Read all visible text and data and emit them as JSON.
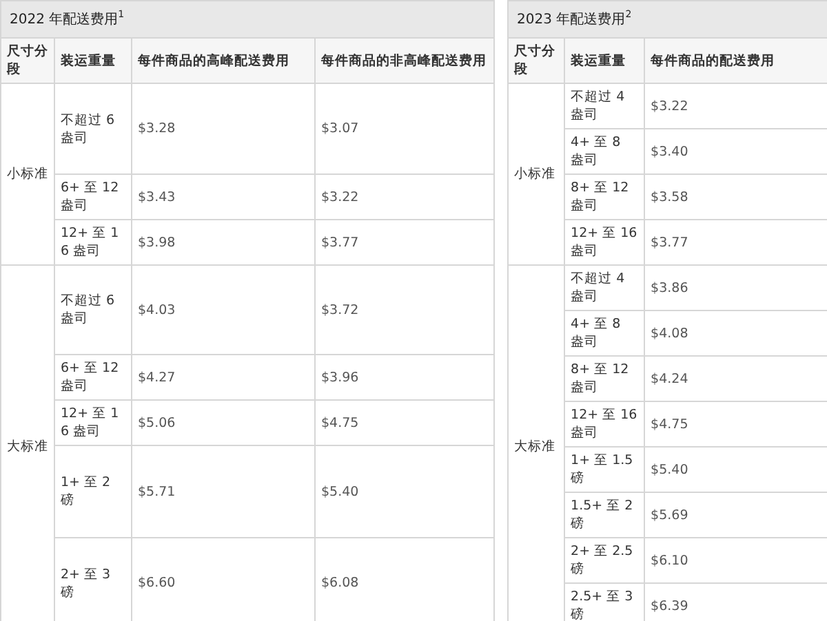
{
  "tables": [
    {
      "title": "2022 年配送费用$^{1}$",
      "columns": [
        "尺寸分段",
        "装运重量",
        "每件商品的高峰配送费用",
        "每件商品的非高峰配送费用"
      ],
      "groups": [
        {
          "size": "小标准",
          "rows": [
            {
              "cells": [
                "不超过 6 盎司",
                "$3.28",
                "$3.07"
              ]
            },
            {
              "cells": [
                "6+ 至 12 盎司",
                "$3.43",
                "$3.22"
              ]
            },
            {
              "cells": [
                "12+ 至 16 盎司",
                "$3.98",
                "$3.77"
              ]
            }
          ]
        },
        {
          "size": "大标准",
          "rows": [
            {
              "cells": [
                "不超过 6 盎司",
                "$4.03",
                "$3.72"
              ]
            },
            {
              "cells": [
                "6+ 至 12 盎司",
                "$4.27",
                "$3.96"
              ]
            },
            {
              "cells": [
                "12+ 至 16 盎司",
                "$5.06",
                "$4.75"
              ]
            },
            {
              "cells": [
                "1+ 至 2 磅",
                "$5.71",
                "$5.40"
              ]
            },
            {
              "cells": [
                "2+ 至 3 磅",
                "$6.60",
                "$6.08"
              ]
            }
          ]
        }
      ]
    },
    {
      "title": "2023 年配送费用$^{2}$",
      "columns": [
        "尺寸分段",
        "装运重量",
        "每件商品的配送费用"
      ],
      "groups": [
        {
          "size": "小标准",
          "rows": [
            {
              "cells": [
                "不超过 4 盎司",
                "$3.22"
              ]
            },
            {
              "cells": [
                "4+ 至 8 盎司",
                "$3.40"
              ]
            },
            {
              "cells": [
                "8+ 至 12 盎司",
                "$3.58"
              ]
            },
            {
              "cells": [
                "12+ 至 16 盎司",
                "$3.77"
              ]
            }
          ]
        },
        {
          "size": "大标准",
          "rows": [
            {
              "cells": [
                "不超过 4 盎司",
                "$3.86"
              ]
            },
            {
              "cells": [
                "4+ 至 8 盎司",
                "$4.08"
              ]
            },
            {
              "cells": [
                "8+ 至 12 盎司",
                "$4.24"
              ]
            },
            {
              "cells": [
                "12+ 至 16 盎司",
                "$4.75"
              ]
            },
            {
              "cells": [
                "1+ 至 1.5 磅",
                "$5.40"
              ]
            },
            {
              "cells": [
                "1.5+ 至 2 磅",
                "$5.69"
              ]
            },
            {
              "cells": [
                "2+ 至 2.5 磅",
                "$6.10"
              ]
            },
            {
              "cells": [
                "2.5+ 至 3 磅",
                "$6.39"
              ]
            }
          ]
        }
      ]
    }
  ]
}
